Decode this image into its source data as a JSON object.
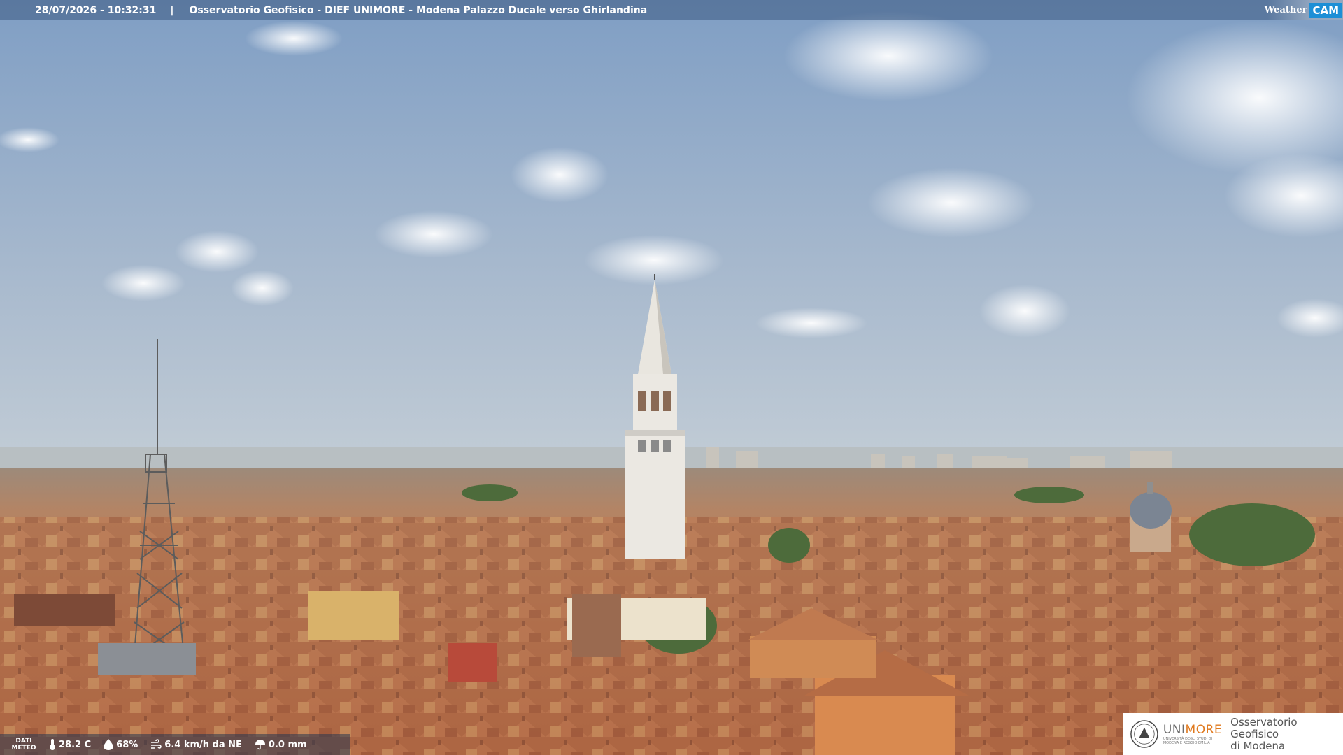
{
  "header": {
    "timestamp": "28/07/2026 - 10:32:31",
    "separator": "|",
    "title": "Osservatorio Geofisico - DIEF UNIMORE - Modena Palazzo Ducale verso Ghirlandina",
    "brand_weather": "Weather",
    "brand_cam": "CAM"
  },
  "weather": {
    "tag_line1": "DATI",
    "tag_line2": "METEO",
    "temperature": "28.2 C",
    "humidity": "68%",
    "wind": "6.4 km/h da NE",
    "rain": "0.0 mm"
  },
  "logo": {
    "uni_prefix": "UNI",
    "uni_suffix": "MORE",
    "uni_sub1": "UNIVERSITÀ DEGLI STUDI DI",
    "uni_sub2": "MODENA E REGGIO EMILIA",
    "obs_line1": "Osservatorio Geofisico",
    "obs_line2": "di Modena"
  },
  "colors": {
    "sky_top": "#8aa6c8",
    "sky_horizon": "#b9c6d2",
    "roof": "#b8704a",
    "tower": "#e8e6e0",
    "accent_orange": "#e07a1f",
    "brand_blue": "#1d8fd6"
  }
}
